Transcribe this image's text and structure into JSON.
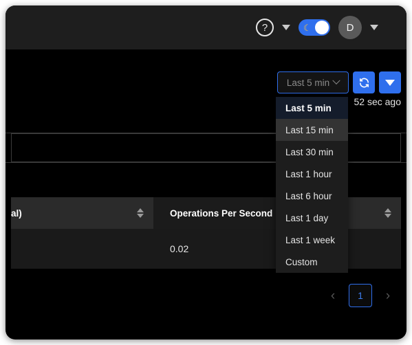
{
  "topbar": {
    "help_icon": "help-circle-icon",
    "help_label": "?",
    "help_caret": "chevron-down-icon",
    "theme_toggle_icon": "moon-icon",
    "theme_toggle_glyph": "☾",
    "avatar_initial": "D",
    "avatar_caret": "chevron-down-icon"
  },
  "toolbar": {
    "range_value": "Last 5 min",
    "refresh_icon": "refresh-icon",
    "refresh_dropdown_icon": "caret-down-icon",
    "updated_text": "52 sec ago"
  },
  "dropdown": {
    "items": [
      {
        "label": "Last 5 min",
        "state": "selected"
      },
      {
        "label": "Last 15 min",
        "state": "hovered"
      },
      {
        "label": "Last 30 min",
        "state": "normal"
      },
      {
        "label": "Last 1 hour",
        "state": "normal"
      },
      {
        "label": "Last 6 hour",
        "state": "normal"
      },
      {
        "label": "Last 1 day",
        "state": "normal"
      },
      {
        "label": "Last 1 week",
        "state": "normal"
      },
      {
        "label": "Custom",
        "state": "normal"
      }
    ]
  },
  "table": {
    "columns": [
      {
        "label": "al)",
        "sortable": true
      },
      {
        "label": "Operations Per Second",
        "sortable": false
      },
      {
        "label": "",
        "sortable": true
      }
    ],
    "rows": [
      {
        "c1": "",
        "c2": "0.02",
        "c3": ""
      }
    ]
  },
  "pagination": {
    "prev_icon": "chevron-left-icon",
    "prev_glyph": "‹",
    "current_page": "1",
    "next_icon": "chevron-right-icon",
    "next_glyph": "›"
  },
  "colors": {
    "accent_blue": "#2f6fed",
    "window_bg": "#000000",
    "topbar_bg": "#1e1e1e",
    "menu_bg": "#1d1d1d"
  }
}
